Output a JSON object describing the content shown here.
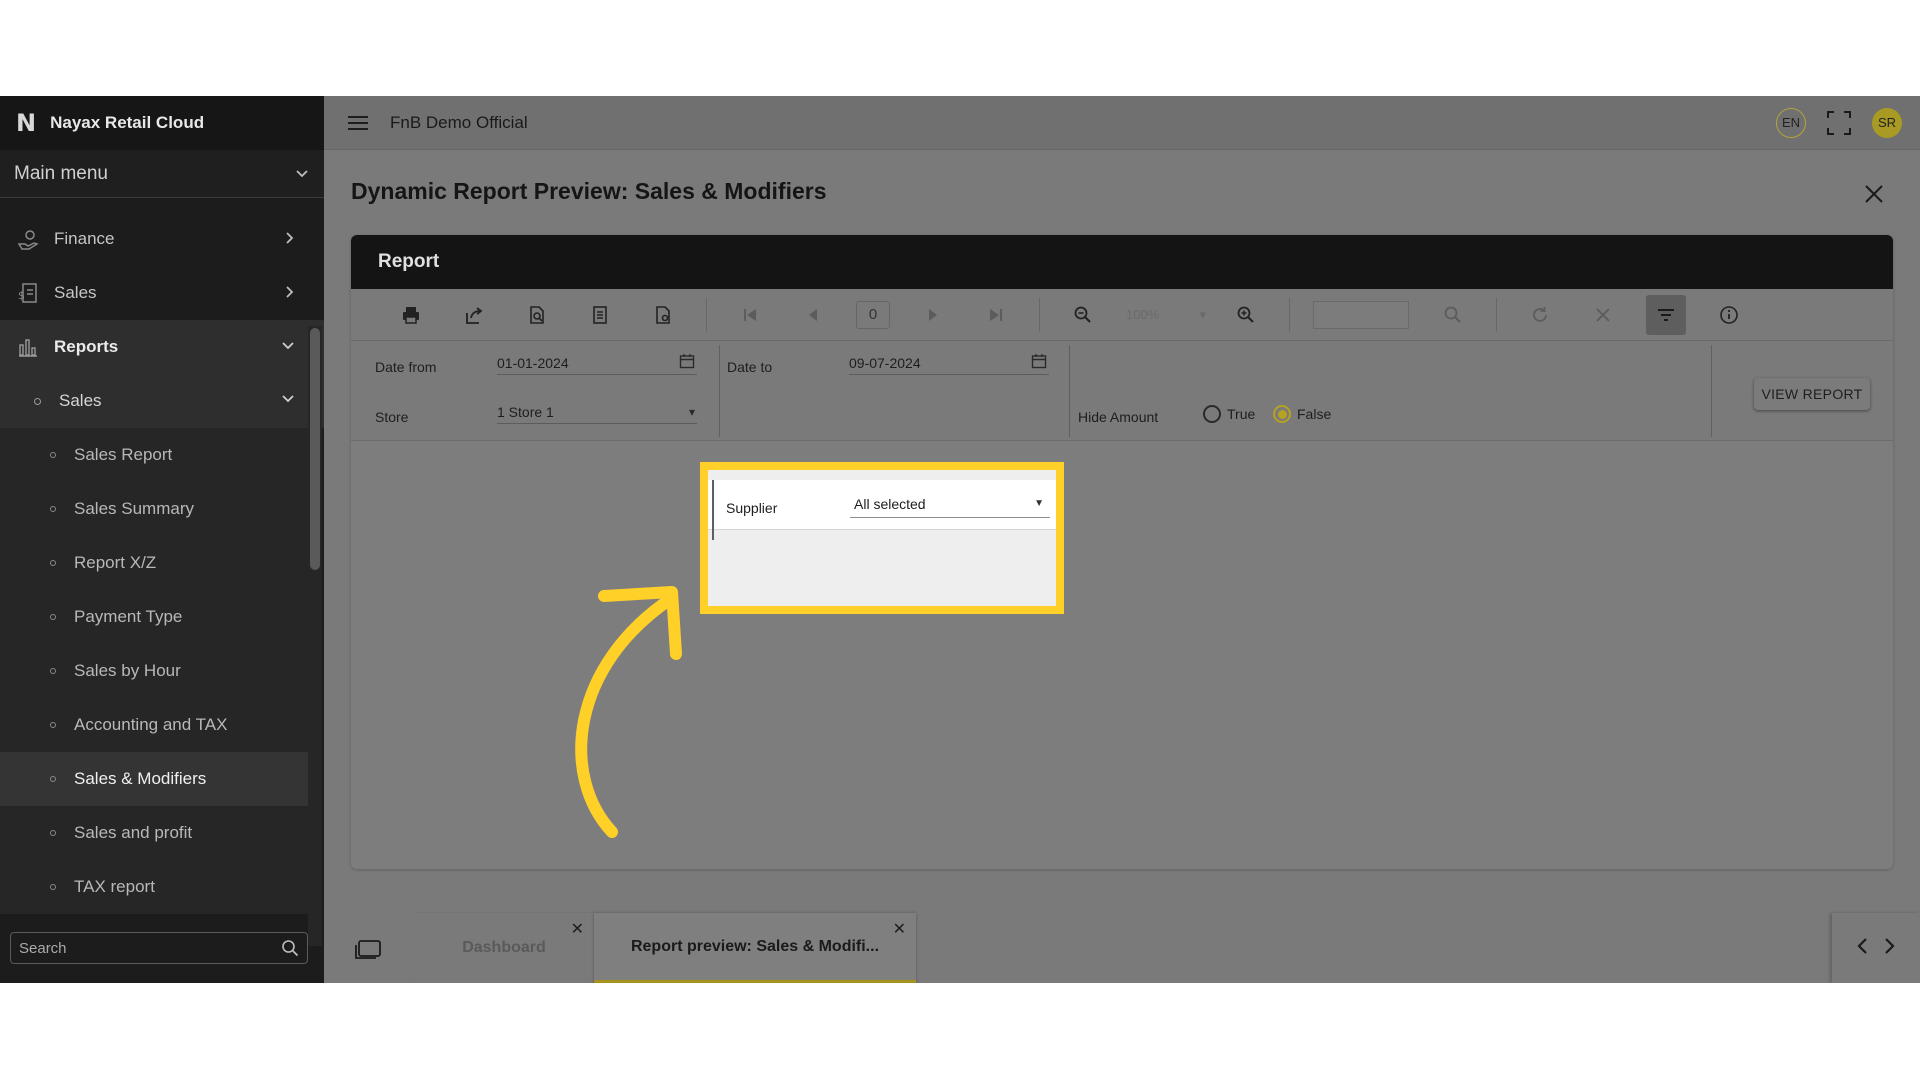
{
  "sidebar": {
    "brand": "Nayax Retail Cloud",
    "brand_logo": "N",
    "main_menu": "Main menu",
    "items": [
      {
        "label": "Finance",
        "icon": "finance-icon"
      },
      {
        "label": "Sales",
        "icon": "sales-icon"
      },
      {
        "label": "Reports",
        "icon": "reports-icon"
      }
    ],
    "submenu": "Sales",
    "leaves": [
      "Sales Report",
      "Sales Summary",
      "Report X/Z",
      "Payment Type",
      "Sales by Hour",
      "Accounting and TAX",
      "Sales & Modifiers",
      "Sales and profit",
      "TAX report"
    ],
    "active_leaf": "Sales & Modifiers",
    "search_placeholder": "Search"
  },
  "topbar": {
    "org": "FnB Demo Official",
    "lang": "EN",
    "avatar": "SR"
  },
  "page": {
    "title": "Dynamic Report Preview: Sales & Modifiers",
    "panel_title": "Report",
    "page_number": "0",
    "zoom": "100%"
  },
  "params": {
    "date_from_label": "Date from",
    "date_from_value": "01-01-2024",
    "date_to_label": "Date to",
    "date_to_value": "09-07-2024",
    "store_label": "Store",
    "store_value": "1 Store 1",
    "supplier_label": "Supplier",
    "supplier_value": "All selected",
    "hide_amount_label": "Hide Amount",
    "radio_true": "True",
    "radio_false": "False",
    "hide_amount_selected": "False",
    "view_report": "VIEW REPORT"
  },
  "tabs": [
    {
      "label": "Dashboard",
      "active": false
    },
    {
      "label": "Report preview: Sales & Modifi...",
      "active": true
    }
  ],
  "colors": {
    "highlight": "#ffd028",
    "accent": "#b5a124",
    "sidebar_bg": "#1c1c1c",
    "header_bg": "#141414"
  }
}
